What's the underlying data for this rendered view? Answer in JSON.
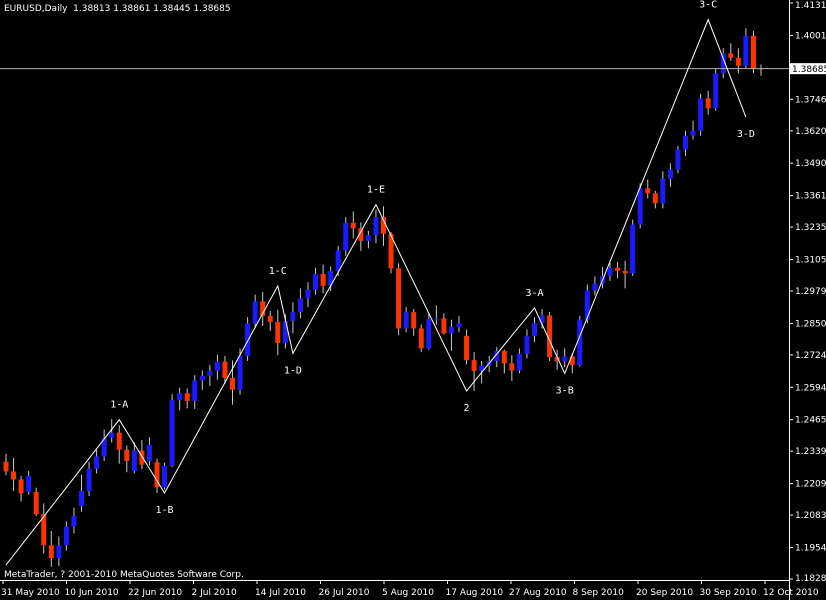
{
  "header": {
    "symbol": "EURUSD,Daily",
    "ohlc": "1.38813 1.38861 1.38445 1.38685"
  },
  "copyright": "MetaTrader, ? 2001-2010 MetaQuotes Software Corp.",
  "colors": {
    "background": "#000000",
    "bull_candle": "#1a1aff",
    "bear_candle": "#ff3300",
    "wick": "#c8c8c8",
    "zigzag": "#ffffff",
    "current_price_line": "#b0b0b0"
  },
  "chart_data": {
    "type": "candlestick",
    "ylim": [
      1.1828,
      1.4131
    ],
    "yticks": [
      "1.41310",
      "1.40015",
      "1.37460",
      "1.36200",
      "1.34905",
      "1.33610",
      "1.32350",
      "1.31055",
      "1.29795",
      "1.28500",
      "1.27240",
      "1.25945",
      "1.24650",
      "1.23390",
      "1.22095",
      "1.20835",
      "1.19540",
      "1.18280"
    ],
    "current_price": "1.38685",
    "xticks": [
      "31 May 2010",
      "10 Jun 2010",
      "22 Jun 2010",
      "2 Jul 2010",
      "14 Jul 2010",
      "26 Jul 2010",
      "5 Aug 2010",
      "17 Aug 2010",
      "27 Aug 2010",
      "8 Sep 2010",
      "20 Sep 2010",
      "30 Sep 2010",
      "12 Oct 2010"
    ],
    "series": [
      {
        "values": [
          [
            1.2297,
            1.2329,
            1.2243,
            1.2258
          ],
          [
            1.2258,
            1.2312,
            1.218,
            1.2226
          ],
          [
            1.2226,
            1.224,
            1.2138,
            1.217
          ],
          [
            1.2175,
            1.226,
            1.2166,
            1.2241
          ],
          [
            1.2176,
            1.2193,
            1.208,
            1.2087
          ],
          [
            1.2087,
            1.213,
            1.193,
            1.1963
          ],
          [
            1.1963,
            1.202,
            1.1877,
            1.1911
          ],
          [
            1.1911,
            1.1997,
            1.188,
            1.1963
          ],
          [
            1.1963,
            1.2058,
            1.1942,
            1.2038
          ],
          [
            1.2038,
            1.2113,
            1.201,
            1.208
          ],
          [
            1.212,
            1.2245,
            1.2097,
            1.218
          ],
          [
            1.218,
            1.2296,
            1.216,
            1.2269
          ],
          [
            1.2269,
            1.2345,
            1.225,
            1.2318
          ],
          [
            1.2318,
            1.2425,
            1.23,
            1.2393
          ],
          [
            1.2393,
            1.2468,
            1.2374,
            1.2413
          ],
          [
            1.2413,
            1.2443,
            1.2289,
            1.2345
          ],
          [
            1.2345,
            1.2362,
            1.2255,
            1.23
          ],
          [
            1.226,
            1.2375,
            1.2251,
            1.2342
          ],
          [
            1.2342,
            1.2384,
            1.2267,
            1.2285
          ],
          [
            1.23,
            1.2395,
            1.2282,
            1.2365
          ],
          [
            1.2295,
            1.231,
            1.2172,
            1.2195
          ],
          [
            1.2195,
            1.2293,
            1.2186,
            1.228
          ],
          [
            1.228,
            1.2567,
            1.2275,
            1.2543
          ],
          [
            1.2543,
            1.2593,
            1.2502,
            1.2571
          ],
          [
            1.2571,
            1.259,
            1.251,
            1.254
          ],
          [
            1.254,
            1.2643,
            1.2507,
            1.2622
          ],
          [
            1.2622,
            1.2662,
            1.2584,
            1.264
          ],
          [
            1.264,
            1.2684,
            1.26,
            1.266
          ],
          [
            1.266,
            1.2725,
            1.2625,
            1.2697
          ],
          [
            1.2697,
            1.272,
            1.2608,
            1.2632
          ],
          [
            1.2632,
            1.2702,
            1.2525,
            1.2585
          ],
          [
            1.2585,
            1.275,
            1.2565,
            1.272
          ],
          [
            1.272,
            1.2875,
            1.27,
            1.285
          ],
          [
            1.285,
            1.2965,
            1.283,
            1.2938
          ],
          [
            1.2938,
            1.2976,
            1.284,
            1.288
          ],
          [
            1.288,
            1.29,
            1.282,
            1.2856
          ],
          [
            1.2856,
            1.2905,
            1.2723,
            1.2772
          ],
          [
            1.2772,
            1.2886,
            1.275,
            1.286
          ],
          [
            1.286,
            1.2935,
            1.281,
            1.2895
          ],
          [
            1.2895,
            1.299,
            1.287,
            1.295
          ],
          [
            1.295,
            1.3015,
            1.2915,
            1.2985
          ],
          [
            1.2985,
            1.3073,
            1.2964,
            1.3048
          ],
          [
            1.3048,
            1.3085,
            1.297,
            1.3
          ],
          [
            1.3,
            1.3078,
            1.298,
            1.306
          ],
          [
            1.306,
            1.316,
            1.304,
            1.3142
          ],
          [
            1.3142,
            1.3275,
            1.312,
            1.3252
          ],
          [
            1.3252,
            1.3298,
            1.319,
            1.323
          ],
          [
            1.323,
            1.3254,
            1.314,
            1.318
          ],
          [
            1.318,
            1.322,
            1.315,
            1.3203
          ],
          [
            1.3203,
            1.3305,
            1.317,
            1.3275
          ],
          [
            1.3275,
            1.3318,
            1.316,
            1.3208
          ],
          [
            1.3208,
            1.3215,
            1.305,
            1.307
          ],
          [
            1.307,
            1.309,
            1.2803,
            1.283
          ],
          [
            1.283,
            1.2916,
            1.2815,
            1.2895
          ],
          [
            1.2895,
            1.2908,
            1.28,
            1.283
          ],
          [
            1.283,
            1.2845,
            1.2735,
            1.275
          ],
          [
            1.275,
            1.289,
            1.2745,
            1.2868
          ],
          [
            1.2868,
            1.2922,
            1.2845,
            1.287
          ],
          [
            1.287,
            1.289,
            1.2805,
            1.281
          ],
          [
            1.281,
            1.2865,
            1.274,
            1.2835
          ],
          [
            1.2835,
            1.288,
            1.2815,
            1.285
          ],
          [
            1.28,
            1.2825,
            1.2686,
            1.2703
          ],
          [
            1.2703,
            1.2735,
            1.258,
            1.266
          ],
          [
            1.266,
            1.27,
            1.261,
            1.268
          ],
          [
            1.268,
            1.272,
            1.2655,
            1.27
          ],
          [
            1.27,
            1.2755,
            1.2675,
            1.274
          ],
          [
            1.274,
            1.2745,
            1.265,
            1.269
          ],
          [
            1.269,
            1.2723,
            1.262,
            1.2662
          ],
          [
            1.2662,
            1.275,
            1.265,
            1.2728
          ],
          [
            1.2728,
            1.2826,
            1.271,
            1.28
          ],
          [
            1.28,
            1.2875,
            1.2775,
            1.285
          ],
          [
            1.285,
            1.2908,
            1.283,
            1.2882
          ],
          [
            1.2882,
            1.2896,
            1.27,
            1.2715
          ],
          [
            1.2715,
            1.2745,
            1.2665,
            1.2698
          ],
          [
            1.2698,
            1.275,
            1.2675,
            1.2718
          ],
          [
            1.2718,
            1.273,
            1.265,
            1.2683
          ],
          [
            1.2683,
            1.288,
            1.2678,
            1.2865
          ],
          [
            1.2865,
            1.3005,
            1.285,
            1.2982
          ],
          [
            1.2982,
            1.3038,
            1.2962,
            1.3009
          ],
          [
            1.3009,
            1.3075,
            1.299,
            1.304
          ],
          [
            1.304,
            1.3092,
            1.302,
            1.3072
          ],
          [
            1.3072,
            1.3095,
            1.303,
            1.306
          ],
          [
            1.306,
            1.31,
            1.299,
            1.305
          ],
          [
            1.305,
            1.3265,
            1.304,
            1.3245
          ],
          [
            1.3245,
            1.341,
            1.323,
            1.339
          ],
          [
            1.339,
            1.3425,
            1.335,
            1.337
          ],
          [
            1.337,
            1.338,
            1.331,
            1.333
          ],
          [
            1.333,
            1.3458,
            1.331,
            1.3428
          ],
          [
            1.3428,
            1.349,
            1.3396,
            1.3465
          ],
          [
            1.3465,
            1.356,
            1.345,
            1.3545
          ],
          [
            1.3545,
            1.362,
            1.352,
            1.36
          ],
          [
            1.36,
            1.366,
            1.3585,
            1.362
          ],
          [
            1.362,
            1.3768,
            1.36,
            1.375
          ],
          [
            1.375,
            1.378,
            1.3685,
            1.371
          ],
          [
            1.371,
            1.387,
            1.37,
            1.385
          ],
          [
            1.385,
            1.395,
            1.383,
            1.393
          ],
          [
            1.393,
            1.397,
            1.39,
            1.3912
          ],
          [
            1.3912,
            1.395,
            1.385,
            1.388
          ],
          [
            1.388,
            1.403,
            1.387,
            1.4
          ],
          [
            1.4,
            1.402,
            1.385,
            1.387
          ],
          [
            1.387,
            1.3885,
            1.384,
            1.38685
          ]
        ]
      }
    ],
    "zigzag_labels": [
      "1-A",
      "1-B",
      "1-C",
      "1-D",
      "1-E",
      "2",
      "3-A",
      "3-B",
      "3-C",
      "3-D"
    ],
    "zigzag": [
      {
        "label": "",
        "bar": 0,
        "price": 1.1884
      },
      {
        "label": "1-A",
        "bar": 15,
        "price": 1.2465
      },
      {
        "label": "1-B",
        "bar": 21,
        "price": 1.2172
      },
      {
        "label": "1-C",
        "bar": 36,
        "price": 1.3
      },
      {
        "label": "1-D",
        "bar": 38,
        "price": 1.273
      },
      {
        "label": "1-E",
        "bar": 49,
        "price": 1.3325
      },
      {
        "label": "2",
        "bar": 61,
        "price": 1.258
      },
      {
        "label": "3-A",
        "bar": 70,
        "price": 1.2912
      },
      {
        "label": "3-B",
        "bar": 74,
        "price": 1.265
      },
      {
        "label": "3-C",
        "bar": 93,
        "price": 1.4065
      },
      {
        "label": "3-D",
        "bar": 98,
        "price": 1.3675
      }
    ]
  }
}
